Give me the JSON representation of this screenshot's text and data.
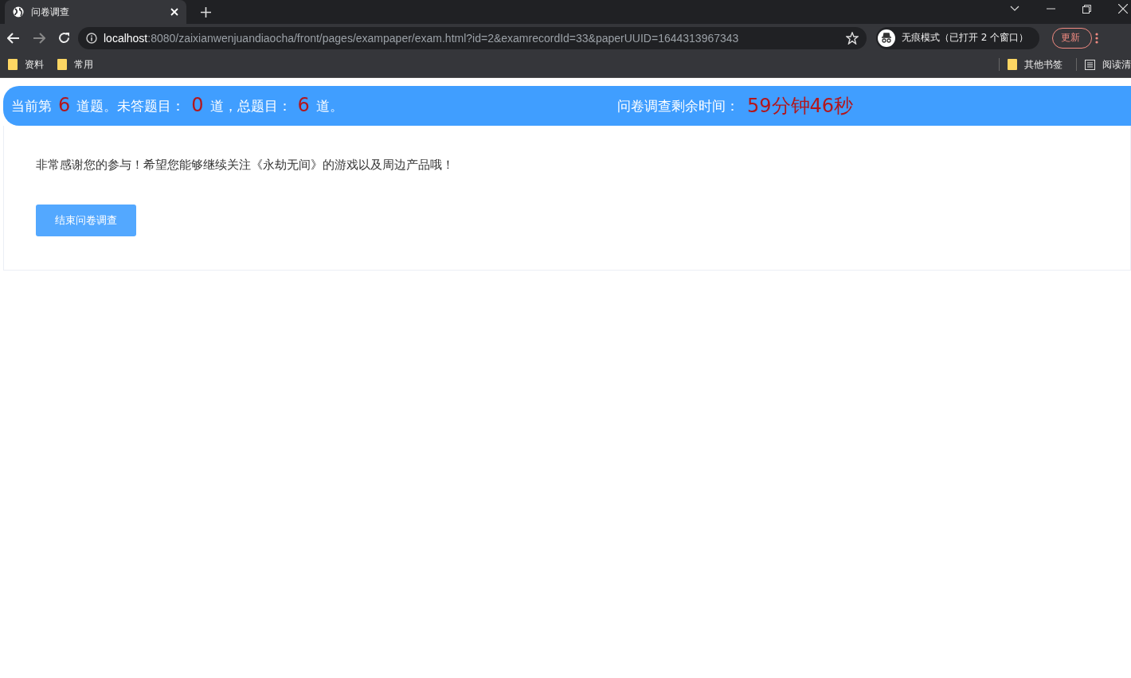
{
  "browser": {
    "tab": {
      "title": "问卷调查"
    },
    "address": {
      "host": "localhost",
      "rest": ":8080/zaixianwenjuandiaocha/front/pages/exampaper/exam.html?id=2&examrecordId=33&paperUUID=1644313967343"
    },
    "incognito": {
      "label": "无痕模式（已打开 2 个窗口）"
    },
    "update_button": "更新",
    "bookmarks": [
      {
        "label": "资料",
        "kind": "folder"
      },
      {
        "label": "常用",
        "kind": "folder"
      }
    ],
    "bookmarks_right": [
      {
        "label": "其他书签",
        "kind": "folder"
      },
      {
        "label": "阅读清",
        "kind": "list"
      }
    ]
  },
  "banner": {
    "progress": [
      {
        "kind": "label",
        "text": "当前第"
      },
      {
        "kind": "number",
        "text": "6"
      },
      {
        "kind": "label",
        "text": "道题。未答题目："
      },
      {
        "kind": "number",
        "text": "0"
      },
      {
        "kind": "label",
        "text": "道，总题目："
      },
      {
        "kind": "number",
        "text": "6"
      },
      {
        "kind": "label",
        "text": "道。"
      }
    ],
    "timer_label": "问卷调查剩余时间：",
    "timer_value": "59分钟46秒"
  },
  "message": "非常感谢您的参与！希望您能够继续关注《永劫无间》的游戏以及周边产品哦！",
  "buttons": [
    "结束问卷调查"
  ]
}
